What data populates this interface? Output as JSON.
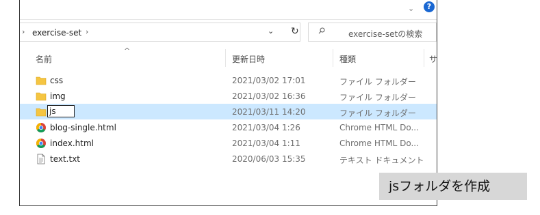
{
  "address": {
    "path": "exercise-set",
    "separator": "›",
    "left_arrow": "›",
    "dropdown": "⌄",
    "refresh": "↻"
  },
  "search": {
    "placeholder": "exercise-setの検索"
  },
  "columns": {
    "name": "名前",
    "date": "更新日時",
    "type": "種類",
    "size": "サ"
  },
  "rows": [
    {
      "name": "css",
      "date": "2021/03/02 17:01",
      "type": "ファイル フォルダー",
      "icon": "folder-icon"
    },
    {
      "name": "img",
      "date": "2021/03/02 16:36",
      "type": "ファイル フォルダー",
      "icon": "folder-icon"
    },
    {
      "name": "js",
      "date": "2021/03/11 14:20",
      "type": "ファイル フォルダー",
      "icon": "folder-icon",
      "selected": true,
      "editing": true
    },
    {
      "name": "blog-single.html",
      "date": "2021/03/04 1:26",
      "type": "Chrome HTML Do...",
      "icon": "chrome-icon"
    },
    {
      "name": "index.html",
      "date": "2021/03/04 1:11",
      "type": "Chrome HTML Do...",
      "icon": "chrome-icon"
    },
    {
      "name": "text.txt",
      "date": "2020/06/03 15:35",
      "type": "テキスト ドキュメント",
      "icon": "text-file-icon"
    }
  ],
  "caption": "jsフォルダを作成",
  "colors": {
    "selection": "#cce8ff",
    "folder": "#f5c542",
    "help": "#1967d2",
    "caption_bg": "#d7d7d7"
  }
}
